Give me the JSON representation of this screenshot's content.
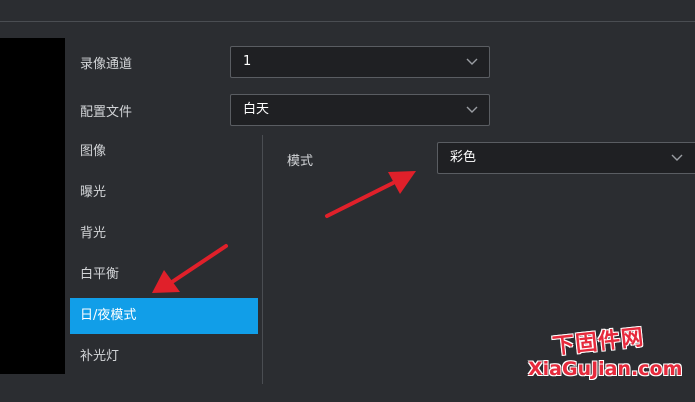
{
  "fields": {
    "record_channel": {
      "label": "录像通道",
      "value": "1"
    },
    "config_file": {
      "label": "配置文件",
      "value": "白天"
    }
  },
  "menu": [
    {
      "label": "图像",
      "active": false
    },
    {
      "label": "曝光",
      "active": false
    },
    {
      "label": "背光",
      "active": false
    },
    {
      "label": "白平衡",
      "active": false
    },
    {
      "label": "日/夜模式",
      "active": true
    },
    {
      "label": "补光灯",
      "active": false
    }
  ],
  "mode": {
    "label": "模式",
    "value": "彩色"
  },
  "watermark": {
    "logo": "下固件网",
    "domain": "XiaGuJian.com"
  },
  "colors": {
    "accent": "#119ee8",
    "arrow": "#e0202a"
  },
  "icons": {
    "dropdown": "chevron-down-icon",
    "annotation": "red-arrow"
  }
}
